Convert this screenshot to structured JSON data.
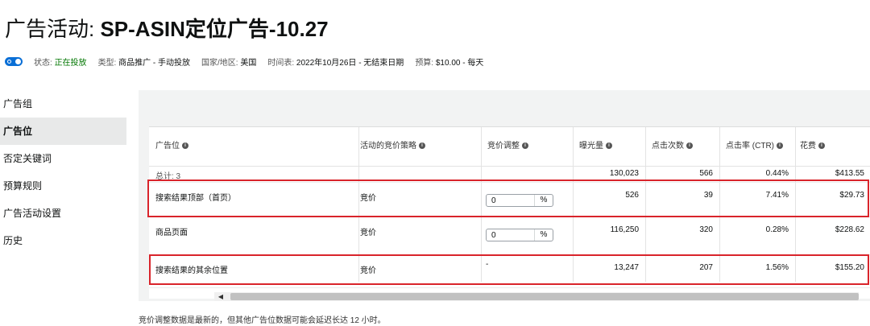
{
  "header": {
    "title_prefix": "广告活动: ",
    "campaign_name": "SP-ASIN定位广告-10.27"
  },
  "meta": {
    "status_label": "状态: ",
    "status_value": "正在投放",
    "type_label": "类型: ",
    "type_value": "商品推广 - 手动投放",
    "country_label": "国家/地区: ",
    "country_value": "美国",
    "schedule_label": "时间表: ",
    "schedule_value": "2022年10月26日 - 无结束日期",
    "budget_label": "预算: ",
    "budget_value": "$10.00 - 每天"
  },
  "sidebar": {
    "items": [
      {
        "label": "广告组"
      },
      {
        "label": "广告位"
      },
      {
        "label": "否定关键词"
      },
      {
        "label": "预算规则"
      },
      {
        "label": "广告活动设置"
      },
      {
        "label": "历史"
      }
    ],
    "active": "广告位"
  },
  "table": {
    "columns": {
      "placement": "广告位",
      "strategy": "活动的竞价策略",
      "bid_adjust": "竞价调整",
      "impressions": "曝光量",
      "clicks": "点击次数",
      "ctr": "点击率 (CTR)",
      "spend": "花费"
    },
    "info_icon": "i",
    "total": {
      "label": "总计: 3",
      "impressions": "130,023",
      "clicks": "566",
      "ctr": "0.44%",
      "spend": "$413.55"
    },
    "rows": [
      {
        "placement": "搜索结果顶部（首页）",
        "strategy": "竞价",
        "bid": "0",
        "unit": "%",
        "impressions": "526",
        "clicks": "39",
        "ctr": "7.41%",
        "spend": "$29.73"
      },
      {
        "placement": "商品页面",
        "strategy": "竞价",
        "bid": "0",
        "unit": "%",
        "impressions": "116,250",
        "clicks": "320",
        "ctr": "0.28%",
        "spend": "$228.62"
      },
      {
        "placement": "搜索结果的其余位置",
        "strategy": "竞价",
        "bid_text": "-",
        "impressions": "13,247",
        "clicks": "207",
        "ctr": "1.56%",
        "spend": "$155.20"
      }
    ],
    "scroll_left": "◀"
  },
  "footer": {
    "note": "竞价调整数据是最新的，但其他广告位数据可能会延迟长达 12 小时。"
  },
  "colors": {
    "accent": "#0a6fd6",
    "status": "#007600",
    "highlight": "#d9242b"
  }
}
